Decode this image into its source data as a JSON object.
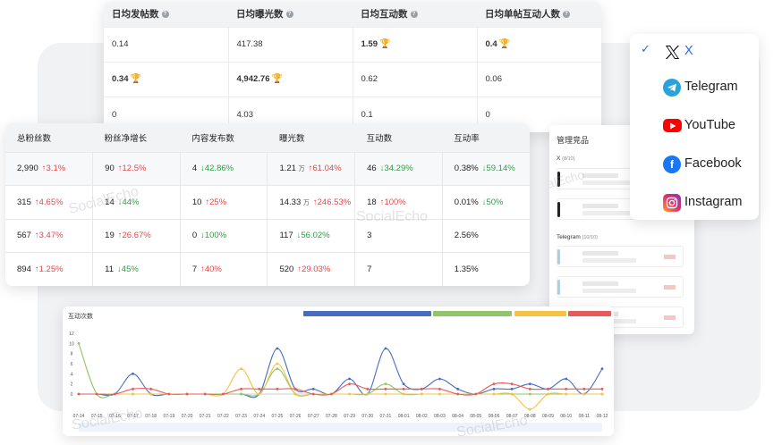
{
  "daily_metrics": {
    "headers": [
      "日均发帖数",
      "日均曝光数",
      "日均互动数",
      "日均单帖互动人数"
    ],
    "rows": [
      [
        {
          "v": "0.14"
        },
        {
          "v": "417.38"
        },
        {
          "v": "1.59",
          "best": true
        },
        {
          "v": "0.4",
          "best": true
        }
      ],
      [
        {
          "v": "0.34",
          "best": true
        },
        {
          "v": "4,942.76",
          "best": true
        },
        {
          "v": "0.62"
        },
        {
          "v": "0.06"
        }
      ],
      [
        {
          "v": "0"
        },
        {
          "v": "4.03"
        },
        {
          "v": "0.1"
        },
        {
          "v": "0"
        }
      ]
    ]
  },
  "stats_table": {
    "headers": [
      "总粉丝数",
      "粉丝净增长",
      "内容发布数",
      "曝光数",
      "互动数",
      "互动率"
    ],
    "rows": [
      [
        {
          "v": "2,990",
          "c": "↑3.1%",
          "d": "up"
        },
        {
          "v": "90",
          "c": "↑12.5%",
          "d": "up"
        },
        {
          "v": "4",
          "c": "↓42.86%",
          "d": "down"
        },
        {
          "v": "1.21",
          "u": "万",
          "c": "↑61.04%",
          "d": "up"
        },
        {
          "v": "46",
          "c": "↓34.29%",
          "d": "down"
        },
        {
          "v": "0.38%",
          "c": "↓59.14%",
          "d": "down"
        }
      ],
      [
        {
          "v": "315",
          "c": "↑4.65%",
          "d": "up"
        },
        {
          "v": "14",
          "c": "↓44%",
          "d": "down"
        },
        {
          "v": "10",
          "c": "↑25%",
          "d": "up"
        },
        {
          "v": "14.33",
          "u": "万",
          "c": "↑246.53%",
          "d": "up"
        },
        {
          "v": "18",
          "c": "↑100%",
          "d": "up"
        },
        {
          "v": "0.01%",
          "c": "↓50%",
          "d": "down"
        }
      ],
      [
        {
          "v": "567",
          "c": "↑3.47%",
          "d": "up"
        },
        {
          "v": "19",
          "c": "↑26.67%",
          "d": "up"
        },
        {
          "v": "0",
          "c": "↓100%",
          "d": "down"
        },
        {
          "v": "117",
          "c": "↓56.02%",
          "d": "down"
        },
        {
          "v": "3",
          "c": "",
          "d": ""
        },
        {
          "v": "2.56%",
          "c": "",
          "d": ""
        }
      ],
      [
        {
          "v": "894",
          "c": "↑1.25%",
          "d": "up"
        },
        {
          "v": "11",
          "c": "↓45%",
          "d": "down"
        },
        {
          "v": "7",
          "c": "↑40%",
          "d": "up"
        },
        {
          "v": "520",
          "c": "↑29.03%",
          "d": "up"
        },
        {
          "v": "7",
          "c": "",
          "d": ""
        },
        {
          "v": "1.35%",
          "c": "",
          "d": ""
        }
      ]
    ]
  },
  "watermarks": [
    "SocialEcho",
    "SocialEcho",
    "SocialEcho",
    "SocialEcho",
    "SocialEcho"
  ],
  "competitors": {
    "title": "管理竞品",
    "sections": [
      {
        "name": "X",
        "count": "(8/10)"
      },
      {
        "name": "Telegram",
        "count": "(10/10)"
      }
    ]
  },
  "platforms": {
    "selected": "X",
    "options": [
      {
        "label": "X",
        "icon": "x-logo-icon",
        "color": "#000000"
      },
      {
        "label": "Telegram",
        "icon": "telegram-icon",
        "color": "#2aa3dc"
      },
      {
        "label": "YouTube",
        "icon": "youtube-icon",
        "color": "#ff0000"
      },
      {
        "label": "Facebook",
        "icon": "facebook-icon",
        "color": "#1877f2"
      },
      {
        "label": "Instagram",
        "icon": "instagram-icon",
        "color": "#d6249f"
      }
    ]
  },
  "chart_data": {
    "type": "line",
    "title": "互动次数",
    "ylim": [
      0,
      12
    ],
    "yticks": [
      "0",
      "2",
      "4",
      "6",
      "8",
      "10",
      "12"
    ],
    "x": [
      "07-14",
      "07-15",
      "07-16",
      "07-17",
      "07-18",
      "07-19",
      "07-20",
      "07-21",
      "07-22",
      "07-23",
      "07-24",
      "07-25",
      "07-26",
      "07-27",
      "07-28",
      "07-29",
      "07-30",
      "07-31",
      "08-01",
      "08-02",
      "08-03",
      "08-04",
      "08-05",
      "08-06",
      "08-07",
      "08-08",
      "08-09",
      "08-10",
      "08-11",
      "08-12"
    ],
    "legend_colors": [
      "#4a6cc0",
      "#92c56a",
      "#f3c343",
      "#e55a5a"
    ],
    "series": [
      {
        "color": "#4a6cc0",
        "values": [
          0,
          0,
          0,
          4,
          0,
          0,
          0,
          0,
          0,
          0,
          0,
          9,
          1,
          1,
          0,
          3,
          0,
          9,
          2,
          1,
          3,
          1,
          0,
          1,
          1,
          2,
          1,
          3,
          0,
          5
        ]
      },
      {
        "color": "#92c56a",
        "values": [
          10,
          0,
          0,
          0,
          0,
          0,
          0,
          0,
          0,
          0,
          0,
          5,
          0,
          0,
          0,
          0,
          0,
          2,
          0,
          0,
          0,
          0,
          0,
          0,
          0,
          0,
          0,
          0,
          0,
          0
        ]
      },
      {
        "color": "#f3c343",
        "values": [
          0,
          0,
          0,
          0,
          0,
          0,
          0,
          0,
          0,
          5,
          0,
          6,
          0,
          0,
          0,
          0,
          0,
          0,
          0,
          0,
          0,
          0,
          0,
          0,
          0,
          -3,
          0,
          0,
          0,
          0
        ]
      },
      {
        "color": "#e55a5a",
        "values": [
          0,
          0,
          0,
          1,
          1,
          0,
          0,
          0,
          0,
          1,
          1,
          1,
          1,
          0,
          0,
          2,
          1,
          1,
          1,
          1,
          1,
          0,
          0,
          2,
          2,
          1,
          1,
          1,
          1,
          1
        ]
      }
    ]
  }
}
